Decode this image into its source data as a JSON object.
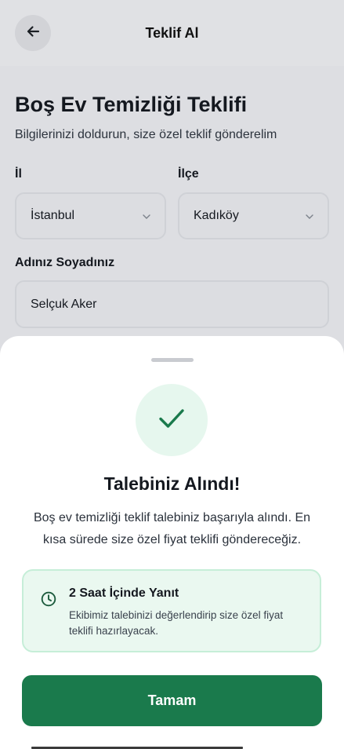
{
  "header": {
    "title": "Teklif Al",
    "back_icon": "arrow-left-icon"
  },
  "form": {
    "title": "Boş Ev Temizliği Teklifi",
    "subtitle": "Bilgilerinizi doldurun, size özel teklif gönderelim",
    "province": {
      "label": "İl",
      "value": "İstanbul"
    },
    "district": {
      "label": "İlçe",
      "value": "Kadıköy"
    },
    "name": {
      "label": "Adınız Soyadınız",
      "value": "Selçuk Aker"
    }
  },
  "sheet": {
    "title": "Talebiniz Alındı!",
    "message": "Boş ev temizliği teklif talebiniz başarıyla alındı. En kısa sürede size özel fiyat teklifi göndereceğiz.",
    "info": {
      "title": "2 Saat İçinde Yanıt",
      "text": "Ekibimiz talebinizi değerlendirip size özel fiyat teklifi hazırlayacak.",
      "icon": "clock-icon"
    },
    "ok_label": "Tamam"
  },
  "colors": {
    "accent": "#1a7a4c",
    "accent_light": "#eaf8f0",
    "success_icon": "#1a7a4c"
  }
}
